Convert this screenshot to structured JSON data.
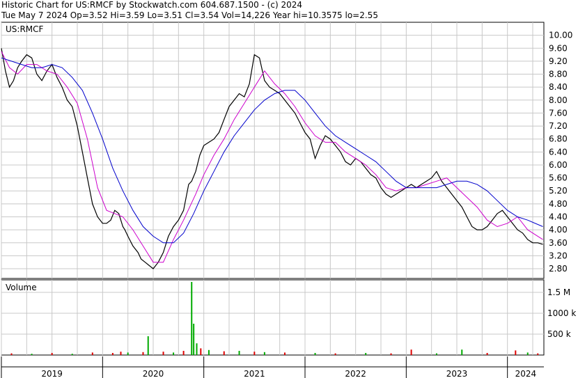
{
  "header": {
    "line1": "Historic Chart for US:RMCF by Stockwatch.com 604.687.1500 - (c) 2024",
    "line2": "Tue May  7 2024  Op=3.52  Hi=3.59  Lo=3.51  Cl=3.54  Vol=14,226  Year hi=10.3575  lo=2.55"
  },
  "colors": {
    "background": "#ffffff",
    "grid": "#c8c8c8",
    "price_line": "#000000",
    "ma_short": "#cc00cc",
    "ma_long": "#0000cc",
    "volume_up": "#00aa00",
    "volume_down": "#dd0000"
  },
  "chart_data": [
    {
      "type": "line",
      "title": "US:RMCF",
      "x_axis": [
        "2019",
        "2020",
        "2021",
        "2022",
        "2023",
        "2024"
      ],
      "ylim": [
        2.5,
        10.4
      ],
      "y_ticks": [
        2.8,
        3.2,
        3.6,
        4.0,
        4.4,
        4.8,
        5.2,
        5.6,
        6.0,
        6.4,
        6.8,
        7.2,
        7.6,
        8.0,
        8.4,
        8.8,
        9.2,
        9.6,
        10.0
      ],
      "y_tick_labels": [
        "2.80",
        "3.20",
        "3.60",
        "4.00",
        "4.40",
        "4.80",
        "5.20",
        "5.60",
        "6.00",
        "6.40",
        "6.80",
        "7.20",
        "7.60",
        "8.00",
        "8.40",
        "8.80",
        "9.20",
        "9.60",
        "10.00"
      ],
      "grid": true,
      "series": [
        {
          "role": "price",
          "x": [
            2019.0,
            2019.04,
            2019.08,
            2019.12,
            2019.16,
            2019.2,
            2019.25,
            2019.3,
            2019.35,
            2019.4,
            2019.45,
            2019.5,
            2019.55,
            2019.6,
            2019.65,
            2019.7,
            2019.75,
            2019.8,
            2019.85,
            2019.9,
            2019.95,
            2020.0,
            2020.04,
            2020.08,
            2020.12,
            2020.16,
            2020.18,
            2020.2,
            2020.22,
            2020.25,
            2020.3,
            2020.35,
            2020.38,
            2020.42,
            2020.46,
            2020.5,
            2020.55,
            2020.6,
            2020.65,
            2020.7,
            2020.75,
            2020.8,
            2020.85,
            2020.88,
            2020.92,
            2020.96,
            2021.0,
            2021.05,
            2021.1,
            2021.15,
            2021.2,
            2021.25,
            2021.3,
            2021.35,
            2021.4,
            2021.45,
            2021.5,
            2021.55,
            2021.6,
            2021.65,
            2021.7,
            2021.75,
            2021.8,
            2021.85,
            2021.9,
            2021.95,
            2022.0,
            2022.05,
            2022.1,
            2022.15,
            2022.2,
            2022.25,
            2022.3,
            2022.35,
            2022.4,
            2022.45,
            2022.5,
            2022.55,
            2022.6,
            2022.65,
            2022.7,
            2022.75,
            2022.8,
            2022.85,
            2022.9,
            2022.95,
            2023.0,
            2023.05,
            2023.1,
            2023.15,
            2023.2,
            2023.25,
            2023.3,
            2023.35,
            2023.4,
            2023.45,
            2023.5,
            2023.55,
            2023.6,
            2023.65,
            2023.7,
            2023.75,
            2023.8,
            2023.85,
            2023.9,
            2023.95,
            2024.0,
            2024.05,
            2024.1,
            2024.15,
            2024.2,
            2024.25,
            2024.3,
            2024.35
          ],
          "y": [
            9.6,
            8.9,
            8.4,
            8.6,
            9.0,
            9.2,
            9.4,
            9.3,
            8.8,
            8.6,
            8.9,
            9.1,
            8.7,
            8.4,
            8.0,
            7.8,
            7.2,
            6.4,
            5.6,
            4.8,
            4.4,
            4.2,
            4.2,
            4.3,
            4.6,
            4.5,
            4.3,
            4.1,
            4.0,
            3.8,
            3.5,
            3.3,
            3.1,
            3.0,
            2.9,
            2.8,
            3.0,
            3.3,
            3.8,
            4.1,
            4.3,
            4.6,
            5.4,
            5.5,
            5.8,
            6.3,
            6.6,
            6.7,
            6.8,
            7.0,
            7.4,
            7.8,
            8.0,
            8.2,
            8.1,
            8.5,
            9.4,
            9.3,
            8.6,
            8.4,
            8.3,
            8.2,
            8.0,
            7.8,
            7.6,
            7.3,
            7.0,
            6.8,
            6.2,
            6.6,
            6.9,
            6.8,
            6.6,
            6.4,
            6.1,
            6.0,
            6.2,
            6.1,
            5.9,
            5.7,
            5.6,
            5.3,
            5.1,
            5.0,
            5.1,
            5.2,
            5.3,
            5.4,
            5.3,
            5.4,
            5.5,
            5.6,
            5.8,
            5.5,
            5.3,
            5.1,
            4.9,
            4.7,
            4.4,
            4.1,
            4.0,
            4.0,
            4.1,
            4.3,
            4.5,
            4.6,
            4.4,
            4.2,
            4.0,
            3.9,
            3.7,
            3.6,
            3.6,
            3.55
          ]
        },
        {
          "role": "moving-average-short",
          "x": [
            2019.0,
            2019.08,
            2019.16,
            2019.25,
            2019.35,
            2019.45,
            2019.55,
            2019.65,
            2019.75,
            2019.85,
            2019.95,
            2020.04,
            2020.12,
            2020.2,
            2020.3,
            2020.42,
            2020.5,
            2020.6,
            2020.7,
            2020.8,
            2020.92,
            2021.0,
            2021.1,
            2021.2,
            2021.3,
            2021.4,
            2021.5,
            2021.6,
            2021.7,
            2021.8,
            2021.9,
            2022.0,
            2022.1,
            2022.2,
            2022.3,
            2022.4,
            2022.5,
            2022.6,
            2022.7,
            2022.8,
            2022.9,
            2023.0,
            2023.1,
            2023.2,
            2023.3,
            2023.4,
            2023.5,
            2023.6,
            2023.7,
            2023.8,
            2023.9,
            2024.0,
            2024.1,
            2024.2,
            2024.35
          ],
          "y": [
            9.5,
            9.0,
            8.8,
            9.1,
            9.1,
            8.9,
            8.8,
            8.4,
            7.9,
            6.8,
            5.3,
            4.6,
            4.5,
            4.4,
            4.0,
            3.4,
            3.0,
            3.0,
            3.7,
            4.3,
            5.1,
            5.7,
            6.3,
            6.8,
            7.4,
            7.9,
            8.4,
            8.9,
            8.5,
            8.2,
            7.8,
            7.3,
            6.9,
            6.7,
            6.7,
            6.4,
            6.2,
            6.0,
            5.7,
            5.3,
            5.2,
            5.3,
            5.3,
            5.4,
            5.5,
            5.6,
            5.3,
            5.0,
            4.7,
            4.3,
            4.1,
            4.2,
            4.4,
            4.0,
            3.7
          ]
        },
        {
          "role": "moving-average-long",
          "x": [
            2019.0,
            2019.1,
            2019.2,
            2019.3,
            2019.4,
            2019.5,
            2019.6,
            2019.7,
            2019.8,
            2019.9,
            2020.0,
            2020.1,
            2020.2,
            2020.3,
            2020.4,
            2020.5,
            2020.6,
            2020.7,
            2020.8,
            2020.9,
            2021.0,
            2021.1,
            2021.2,
            2021.3,
            2021.4,
            2021.5,
            2021.6,
            2021.7,
            2021.8,
            2021.9,
            2022.0,
            2022.1,
            2022.2,
            2022.3,
            2022.4,
            2022.5,
            2022.6,
            2022.7,
            2022.8,
            2022.9,
            2023.0,
            2023.1,
            2023.2,
            2023.3,
            2023.4,
            2023.5,
            2023.6,
            2023.7,
            2023.8,
            2023.9,
            2024.0,
            2024.1,
            2024.2,
            2024.35
          ],
          "y": [
            9.3,
            9.2,
            9.1,
            9.0,
            9.0,
            9.1,
            9.0,
            8.7,
            8.3,
            7.6,
            6.8,
            5.9,
            5.2,
            4.6,
            4.1,
            3.8,
            3.6,
            3.6,
            3.9,
            4.5,
            5.2,
            5.8,
            6.4,
            6.9,
            7.3,
            7.7,
            8.0,
            8.2,
            8.3,
            8.3,
            8.0,
            7.6,
            7.2,
            6.9,
            6.7,
            6.5,
            6.3,
            6.1,
            5.8,
            5.5,
            5.3,
            5.3,
            5.3,
            5.3,
            5.4,
            5.5,
            5.5,
            5.4,
            5.2,
            4.9,
            4.6,
            4.4,
            4.3,
            4.1
          ]
        }
      ]
    },
    {
      "type": "bar",
      "title": "Volume",
      "y_tick_labels": [
        "500 k",
        "1000 k",
        "1.5 M"
      ],
      "y_ticks": [
        500000,
        1000000,
        1500000
      ],
      "ylim": [
        0,
        1800000
      ],
      "bars": [
        {
          "x": 2019.1,
          "v": 40000,
          "c": "down"
        },
        {
          "x": 2019.3,
          "v": 30000,
          "c": "up"
        },
        {
          "x": 2019.5,
          "v": 50000,
          "c": "down"
        },
        {
          "x": 2019.7,
          "v": 30000,
          "c": "up"
        },
        {
          "x": 2019.9,
          "v": 60000,
          "c": "down"
        },
        {
          "x": 2020.1,
          "v": 50000,
          "c": "down"
        },
        {
          "x": 2020.18,
          "v": 80000,
          "c": "down"
        },
        {
          "x": 2020.25,
          "v": 60000,
          "c": "up"
        },
        {
          "x": 2020.4,
          "v": 70000,
          "c": "down"
        },
        {
          "x": 2020.45,
          "v": 450000,
          "c": "up"
        },
        {
          "x": 2020.6,
          "v": 80000,
          "c": "down"
        },
        {
          "x": 2020.7,
          "v": 60000,
          "c": "up"
        },
        {
          "x": 2020.8,
          "v": 100000,
          "c": "down"
        },
        {
          "x": 2020.88,
          "v": 1750000,
          "c": "up"
        },
        {
          "x": 2020.9,
          "v": 750000,
          "c": "up"
        },
        {
          "x": 2020.93,
          "v": 280000,
          "c": "up"
        },
        {
          "x": 2020.97,
          "v": 160000,
          "c": "down"
        },
        {
          "x": 2021.05,
          "v": 120000,
          "c": "up"
        },
        {
          "x": 2021.2,
          "v": 90000,
          "c": "down"
        },
        {
          "x": 2021.35,
          "v": 100000,
          "c": "up"
        },
        {
          "x": 2021.5,
          "v": 80000,
          "c": "down"
        },
        {
          "x": 2021.6,
          "v": 70000,
          "c": "up"
        },
        {
          "x": 2021.8,
          "v": 60000,
          "c": "down"
        },
        {
          "x": 2022.1,
          "v": 50000,
          "c": "up"
        },
        {
          "x": 2022.3,
          "v": 40000,
          "c": "down"
        },
        {
          "x": 2022.6,
          "v": 50000,
          "c": "up"
        },
        {
          "x": 2022.85,
          "v": 40000,
          "c": "down"
        },
        {
          "x": 2023.05,
          "v": 130000,
          "c": "down"
        },
        {
          "x": 2023.3,
          "v": 40000,
          "c": "up"
        },
        {
          "x": 2023.55,
          "v": 130000,
          "c": "up"
        },
        {
          "x": 2023.8,
          "v": 50000,
          "c": "down"
        },
        {
          "x": 2024.08,
          "v": 110000,
          "c": "down"
        },
        {
          "x": 2024.2,
          "v": 60000,
          "c": "up"
        },
        {
          "x": 2024.3,
          "v": 40000,
          "c": "down"
        }
      ]
    }
  ]
}
